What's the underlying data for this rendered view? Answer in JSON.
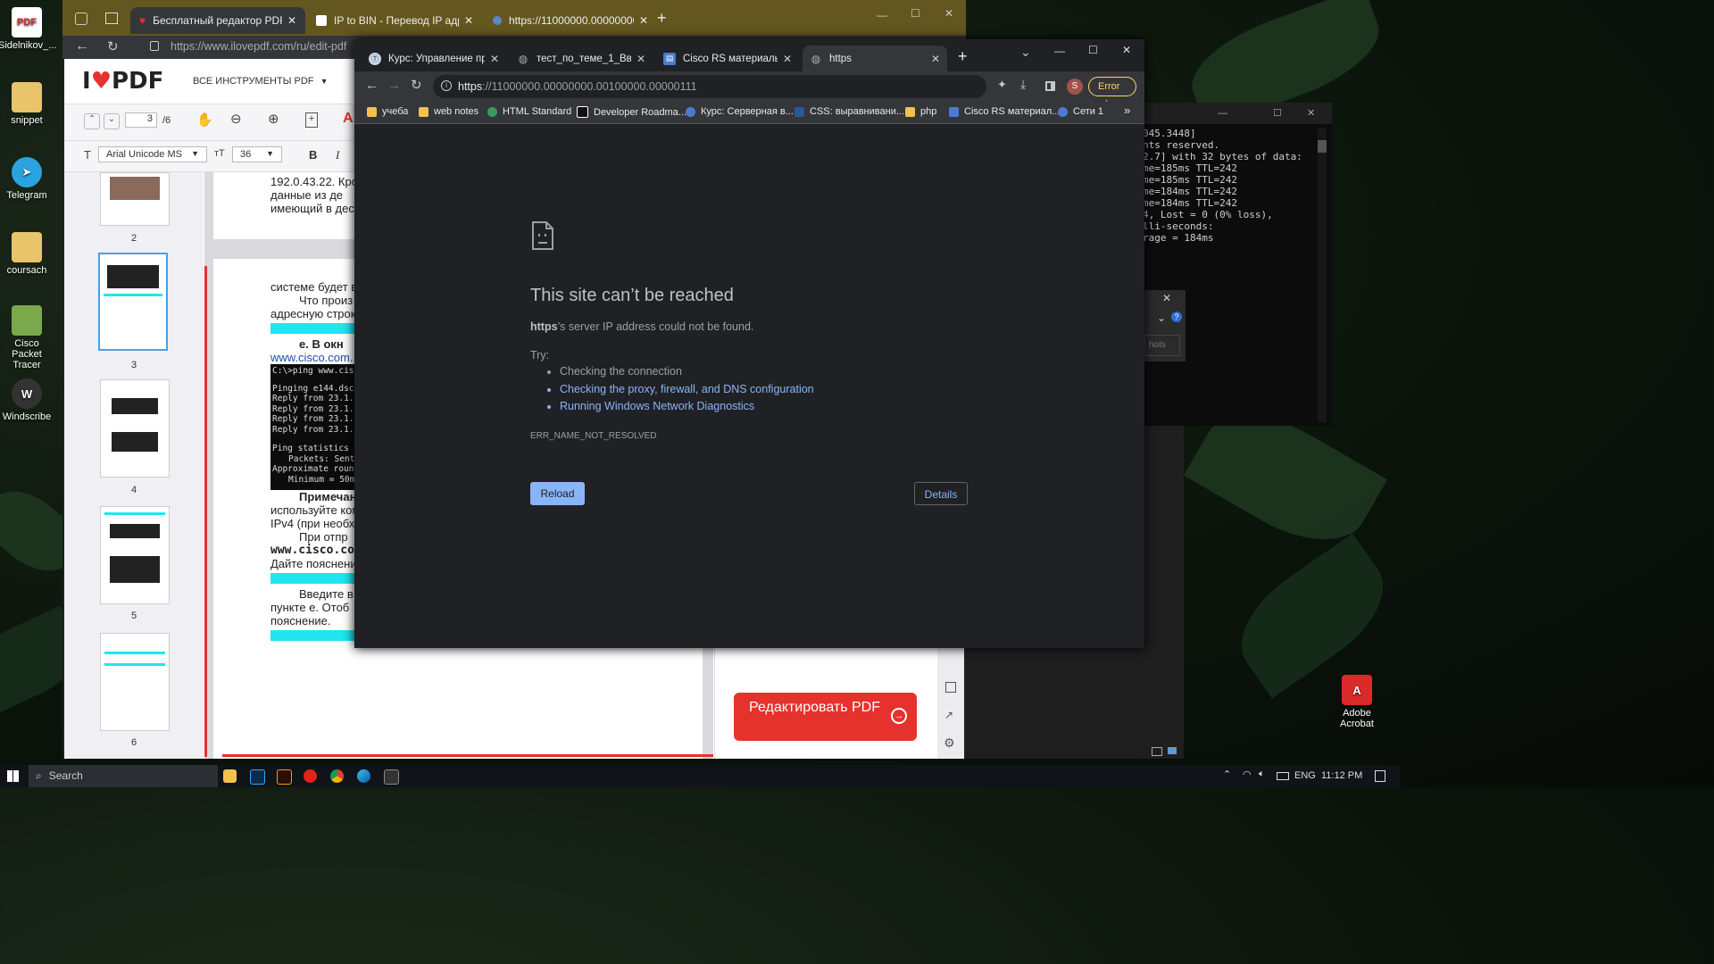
{
  "desktop": {
    "icons": [
      {
        "label": "Sidelnikov_...",
        "glyph": "PDF",
        "color": "#d92a2a"
      },
      {
        "label": "snippet",
        "glyph": "",
        "color": "#e8c46a"
      },
      {
        "label": "Telegram",
        "glyph": "➤",
        "color": "#2aa3e0"
      },
      {
        "label": "coursach",
        "glyph": "",
        "color": "#e8c46a"
      },
      {
        "label": "Cisco Packet Tracer",
        "glyph": "",
        "color": "#7aa84a"
      },
      {
        "label": "Windscribe",
        "glyph": "W",
        "color": "#333"
      }
    ],
    "right_icon": {
      "label": "Adobe Acrobat",
      "glyph": "A",
      "color": "#d92a2a"
    }
  },
  "back_browser": {
    "tabs": [
      {
        "label": "Бесплатный редактор PDF-фай",
        "close": "✕",
        "active": true
      },
      {
        "label": "IP to BIN - Перевод IP адреса в",
        "close": "✕",
        "active": false
      },
      {
        "label": "https://11000000.00000000.001(",
        "close": "✕",
        "active": false
      }
    ],
    "new_tab": "+",
    "url": "https://www.ilovepdf.com/ru/edit-pdf",
    "window_controls": {
      "min": "—",
      "max": "☐",
      "close": "✕"
    },
    "site": {
      "logo_i": "I",
      "logo_heart": "♥",
      "logo_pdf": "PDF",
      "all_tools": "ВСЕ ИНСТРУМЕНТЫ PDF",
      "page_current": "3",
      "page_total": "/6",
      "font_name": "Arial Unicode MS",
      "font_size": "36",
      "bold": "B",
      "italic": "I",
      "thumb_numbers": [
        "2",
        "3",
        "4",
        "5",
        "6"
      ],
      "doc_lines_top": [
        "192.0.43.22. Кро",
        "данные из де",
        "имеющий в дес"
      ],
      "doc_lines": [
        "системе будет в",
        "Что произ",
        "адресную строк",
        "е. В окн",
        "www.cisco.com.",
        "C:\\>ping www.cis",
        "Pinging e144.dscb",
        "Reply from 23.1.1",
        "Reply from 23.1.1",
        "Reply from 23.1.1",
        "Reply from 23.1.1",
        "Ping statistics f",
        "Packets: Sent",
        "Approximate round",
        "Minimum = 50m",
        "Примечан",
        "используйте ком",
        "IPv4 (при необх",
        "При отпр",
        "www.cisco.co",
        "Дайте пояснени",
        "Введите в",
        "пункте е. Отоб",
        "пояснение."
      ],
      "edit_button": "Редактировать PDF"
    }
  },
  "terminal": {
    "window_controls": {
      "min": "—",
      "max": "☐",
      "close": "✕"
    },
    "lines": [
      "045.3448]",
      "nts reserved.",
      "",
      "",
      "2.7] with 32 bytes of data:",
      "me=185ms TTL=242",
      "me=185ms TTL=242",
      "me=184ms TTL=242",
      "me=184ms TTL=242",
      "",
      "",
      "4, Lost = 0 (0% loss),",
      "lli-seconds:",
      "rage = 184ms"
    ],
    "popup_close": "✕",
    "popup_text": "hots"
  },
  "chrome": {
    "tabs": [
      {
        "label": "Курс: Управление прое",
        "icon": "Ⓣ",
        "active": false
      },
      {
        "label": "тест_по_теме_1_Введен",
        "icon": "◍",
        "active": false
      },
      {
        "label": "Cisco RS материалы для",
        "icon": "▤",
        "active": false
      },
      {
        "label": "https",
        "icon": "◍",
        "active": true
      }
    ],
    "tab_close": "✕",
    "new_tab": "+",
    "window_controls": {
      "dropdown": "⌄",
      "min": "—",
      "max": "☐",
      "close": "✕"
    },
    "url_scheme": "https",
    "url_rest": "://11000000.00000000.00100000.00000111",
    "profile": "S",
    "error_badge": "Error",
    "bookmarks": [
      {
        "label": "учеба",
        "color": "#f2c14e"
      },
      {
        "label": "web notes",
        "color": "#f2c14e"
      },
      {
        "label": "HTML Standard",
        "color": "#3c9a5f"
      },
      {
        "label": "Developer Roadma...",
        "color": "#111"
      },
      {
        "label": "Курс: Серверная в...",
        "color": "#4a7bd0"
      },
      {
        "label": "CSS: выравнивани...",
        "color": "#2b5797"
      },
      {
        "label": "php",
        "color": "#f2c14e"
      },
      {
        "label": "Cisco RS материал...",
        "color": "#4a7bd0"
      },
      {
        "label": "Сети 1",
        "color": "#4a7bd0"
      }
    ],
    "bookmarks_more": "»",
    "error_page": {
      "title": "This site can’t be reached",
      "host": "https",
      "message": "’s server IP address could not be found.",
      "try": "Try:",
      "suggestions": [
        {
          "text": "Checking the connection",
          "link": false
        },
        {
          "text": "Checking the proxy, firewall, and DNS configuration",
          "link": true
        },
        {
          "text": "Running Windows Network Diagnostics",
          "link": true
        }
      ],
      "error_code": "ERR_NAME_NOT_RESOLVED",
      "reload": "Reload",
      "details": "Details"
    },
    "colors": {
      "accent": "#8ab4f8",
      "error_badge": "#fdd663"
    }
  },
  "taskbar": {
    "search": "Search",
    "language": "ENG",
    "time": "11:12 PM"
  }
}
